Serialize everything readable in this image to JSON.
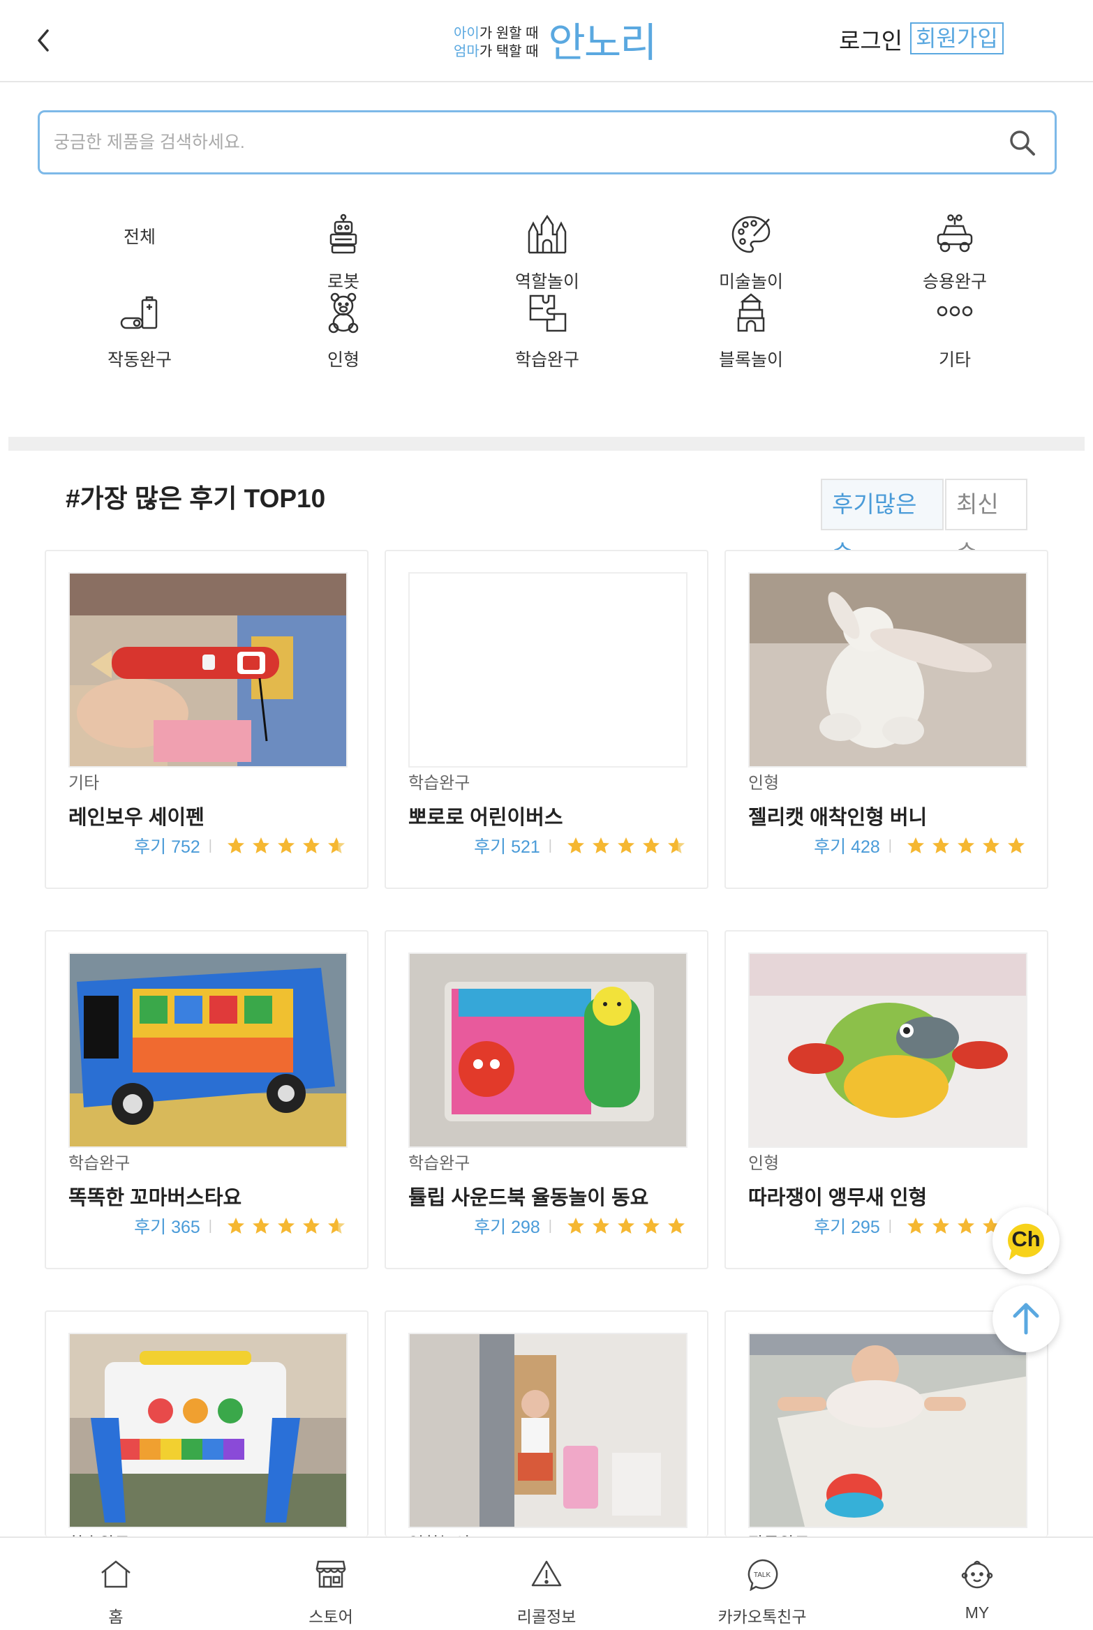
{
  "header": {
    "logo_line1_hl": "아이",
    "logo_line1": "가 원할 때",
    "logo_line2_hl": "엄마",
    "logo_line2": "가 택할 때",
    "logo_main": "안노리",
    "login": "로그인",
    "signup": "회원가입"
  },
  "search": {
    "placeholder": "궁금한 제품을 검색하세요."
  },
  "categories": [
    {
      "label": "전체",
      "icon": "all"
    },
    {
      "label": "로봇",
      "icon": "robot-icon"
    },
    {
      "label": "역할놀이",
      "icon": "castle-icon"
    },
    {
      "label": "미술놀이",
      "icon": "palette-icon"
    },
    {
      "label": "승용완구",
      "icon": "car-icon"
    },
    {
      "label": "작동완구",
      "icon": "battery-icon"
    },
    {
      "label": "인형",
      "icon": "teddy-bear-icon"
    },
    {
      "label": "학습완구",
      "icon": "puzzle-icon"
    },
    {
      "label": "블록놀이",
      "icon": "block-tower-icon"
    },
    {
      "label": "기타",
      "icon": "more-icon"
    }
  ],
  "section": {
    "title": "#가장 많은 후기 TOP10",
    "sort_active": "후기많은순",
    "sort_inactive": "최신순"
  },
  "products": [
    {
      "category": "기타",
      "name": "레인보우 세이펜",
      "reviews": "후기 752",
      "rating": 4.5
    },
    {
      "category": "학습완구",
      "name": "뽀로로 어린이버스",
      "reviews": "후기 521",
      "rating": 4.5
    },
    {
      "category": "인형",
      "name": "젤리캣 애착인형 버니",
      "reviews": "후기 428",
      "rating": 5
    },
    {
      "category": "학습완구",
      "name": "똑똑한 꼬마버스타요",
      "reviews": "후기 365",
      "rating": 4.5
    },
    {
      "category": "학습완구",
      "name": "튤립 사운드북 율동놀이 동요",
      "reviews": "후기 298",
      "rating": 5
    },
    {
      "category": "인형",
      "name": "따라쟁이 앵무새 인형",
      "reviews": "후기 295",
      "rating": 4.5
    },
    {
      "category": "학습완구",
      "name": "",
      "reviews": "",
      "rating": 0
    },
    {
      "category": "역할놀이",
      "name": "",
      "reviews": "",
      "rating": 0
    },
    {
      "category": "작동완구",
      "name": "",
      "reviews": "",
      "rating": 0
    }
  ],
  "floating": {
    "channel_label": "Ch"
  },
  "bottom_nav": [
    {
      "label": "홈",
      "icon": "home-icon"
    },
    {
      "label": "스토어",
      "icon": "store-icon"
    },
    {
      "label": "리콜정보",
      "icon": "warning-icon"
    },
    {
      "label": "카카오톡친구",
      "icon": "talk-icon",
      "icon_text": "TALK"
    },
    {
      "label": "MY",
      "icon": "baby-face-icon"
    }
  ],
  "colors": {
    "accent": "#5aa8e0",
    "star": "#f5b731"
  }
}
